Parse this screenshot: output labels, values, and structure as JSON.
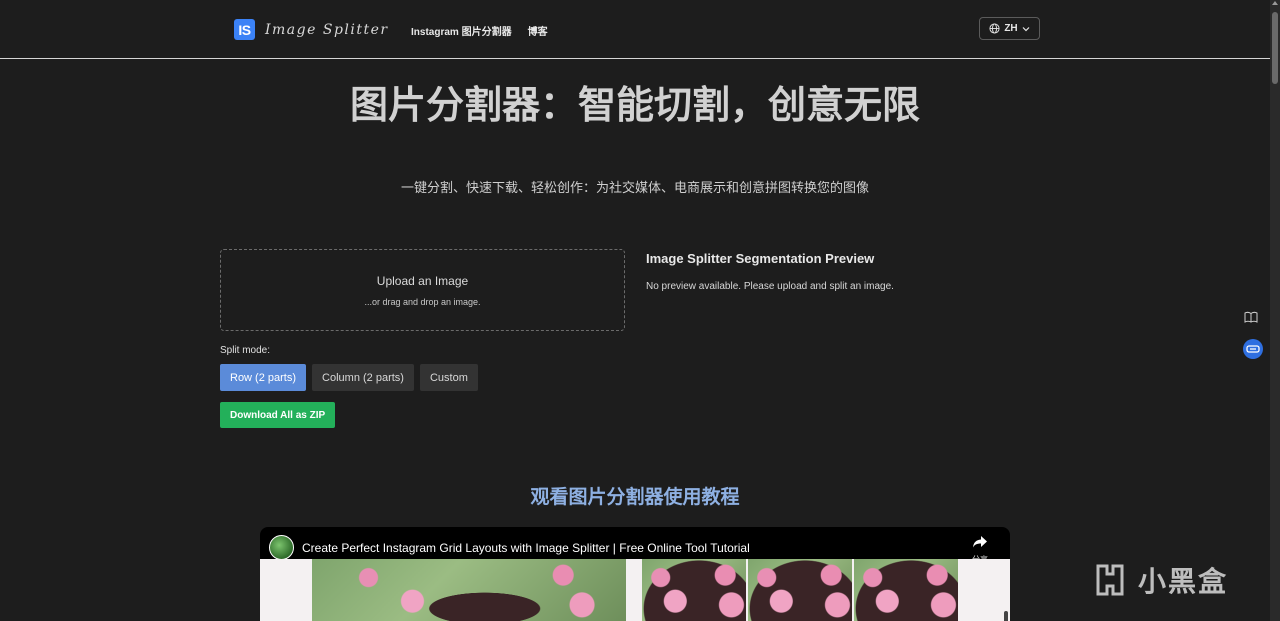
{
  "header": {
    "logo_badge": "IS",
    "logo_text": "Image Splitter",
    "nav": [
      "Instagram 图片分割器",
      "博客"
    ],
    "language": "ZH"
  },
  "hero": {
    "title": "图片分割器：智能切割，创意无限",
    "subtitle": "一键分割、快速下载、轻松创作：为社交媒体、电商展示和创意拼图转换您的图像"
  },
  "upload": {
    "title": "Upload an Image",
    "hint": "...or drag and drop an image."
  },
  "preview": {
    "title": "Image Splitter Segmentation Preview",
    "message": "No preview available. Please upload and split an image."
  },
  "split": {
    "label": "Split mode:",
    "modes": [
      "Row (2 parts)",
      "Column (2 parts)",
      "Custom"
    ],
    "active_mode": "Row (2 parts)"
  },
  "download_zip": "Download All as ZIP",
  "tutorial": {
    "title": "观看图片分割器使用教程",
    "video_title": "Create Perfect Instagram Grid Layouts with Image Splitter | Free Online Tool Tutorial",
    "share_label": "分享"
  },
  "watermark": "小黑盒",
  "colors": {
    "background": "#1d1d1d",
    "primary_button": "#5b8bd9",
    "download_button": "#23b05a",
    "tutorial_title": "#8eb0e2",
    "logo_badge": "#3b82f6"
  },
  "icons": [
    "globe-icon",
    "chevron-down-icon",
    "share-icon",
    "book-icon",
    "vr-icon"
  ]
}
